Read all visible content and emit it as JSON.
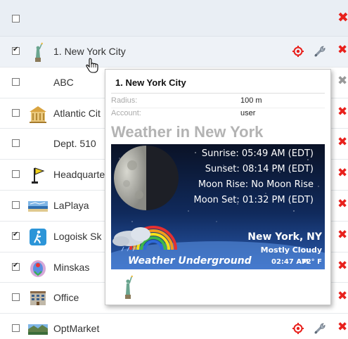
{
  "colors": {
    "header_bg": "#e9eef4",
    "delete_red": "#e8201c",
    "highlight_row": "#eef2f7",
    "weather_bg": "#0b1630"
  },
  "header": {
    "checked": false,
    "delete_icon": "close-icon"
  },
  "rows": [
    {
      "label": "1. New York City",
      "checked": true,
      "icon": "statue-of-liberty-icon"
    },
    {
      "label": "ABC",
      "checked": false,
      "icon": ""
    },
    {
      "label": "Atlantic Cit",
      "checked": false,
      "icon": "building-icon"
    },
    {
      "label": "Dept. 510",
      "checked": false,
      "icon": ""
    },
    {
      "label": "Headquarte",
      "checked": false,
      "icon": "flag-icon"
    },
    {
      "label": "LaPlaya",
      "checked": false,
      "icon": "beach-icon"
    },
    {
      "label": "Logoisk Sk",
      "checked": true,
      "icon": "skier-icon"
    },
    {
      "label": "Minskas",
      "checked": true,
      "icon": "emblem-icon"
    },
    {
      "label": "Office",
      "checked": false,
      "icon": "office-building-icon"
    },
    {
      "label": "OptMarket",
      "checked": false,
      "icon": "landscape-icon"
    }
  ],
  "popup": {
    "title": "1. New York City",
    "radius_label": "Radius:",
    "radius_value": "100 m",
    "account_label": "Account:",
    "account_value": "user",
    "weather_title": "Weather in New York",
    "sunrise": "Sunrise: 05:49 AM (EDT)",
    "sunset": "Sunset: 08:14 PM (EDT)",
    "moonrise": "Moon Rise: No Moon Rise",
    "moonset": "Moon Set: 01:32 PM (EDT)",
    "city": "New York, NY",
    "condition": "Mostly Cloudy",
    "brand": "Weather Underground",
    "time": "02:47 AM",
    "temp": "72° F"
  }
}
